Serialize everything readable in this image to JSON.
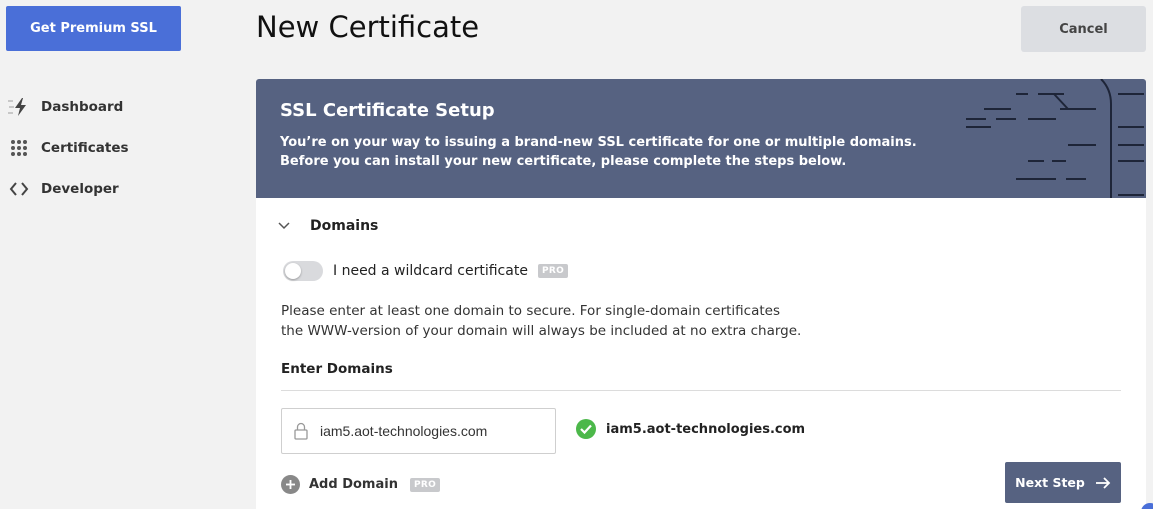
{
  "sidebar": {
    "premium_button": "Get Premium SSL",
    "items": [
      {
        "label": "Dashboard",
        "icon": "lightning-icon"
      },
      {
        "label": "Certificates",
        "icon": "grid-dots-icon"
      },
      {
        "label": "Developer",
        "icon": "code-brackets-icon"
      }
    ]
  },
  "header": {
    "title": "New Certificate",
    "cancel_label": "Cancel"
  },
  "banner": {
    "title": "SSL Certificate Setup",
    "line1": "You’re on your way to issuing a brand-new SSL certificate for one or multiple domains.",
    "line2": "Before you can install your new certificate, please complete the steps below."
  },
  "domains": {
    "section_label": "Domains",
    "wildcard_label": "I need a wildcard certificate",
    "wildcard_enabled": false,
    "pro_badge": "PRO",
    "info_line1": "Please enter at least one domain to secure. For single-domain certificates",
    "info_line2": "the WWW-version of your domain will always be included at no extra charge.",
    "enter_label": "Enter Domains",
    "input_value": "iam5.aot-technologies.com",
    "validated_domain": "iam5.aot-technologies.com",
    "add_domain_label": "Add Domain",
    "add_domain_badge": "PRO",
    "next_label": "Next Step"
  },
  "colors": {
    "accent": "#4a6fd8",
    "banner": "#566281",
    "success": "#4cb84a"
  }
}
